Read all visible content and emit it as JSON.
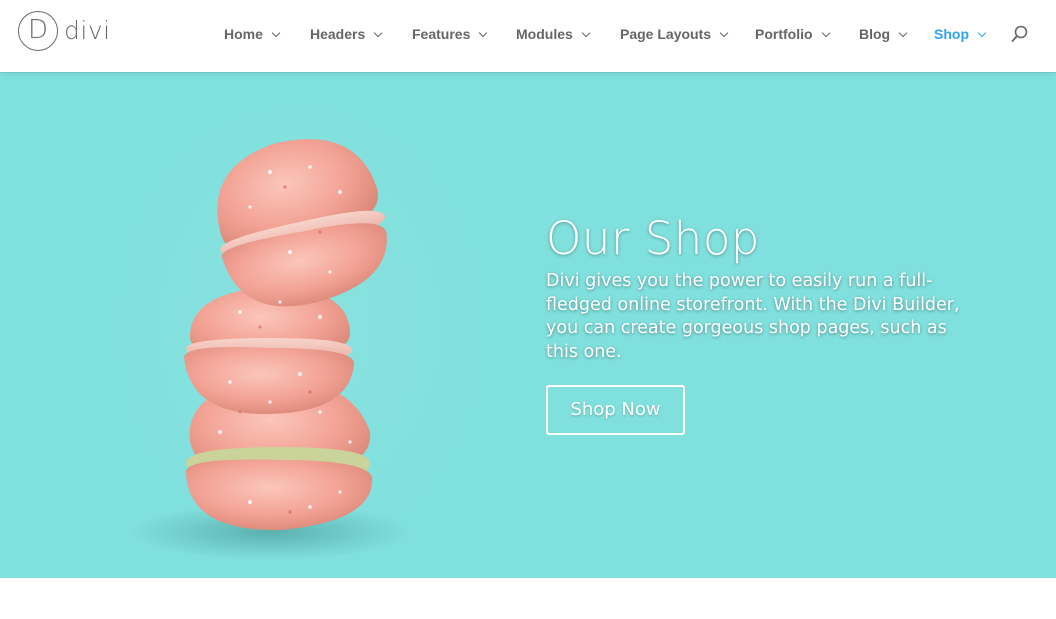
{
  "brand": {
    "logo_letter": "D",
    "logo_word": "divi"
  },
  "nav": {
    "items": [
      {
        "label": "Home"
      },
      {
        "label": "Headers"
      },
      {
        "label": "Features"
      },
      {
        "label": "Modules"
      },
      {
        "label": "Page Layouts"
      },
      {
        "label": "Portfolio"
      },
      {
        "label": "Blog"
      },
      {
        "label": "Shop",
        "active": true
      }
    ],
    "search_icon": "search-icon"
  },
  "hero": {
    "title": "Our Shop",
    "description": "Divi gives you the power to easily run a full-fledged online storefront. With the Divi Builder, you can create gorgeous shop pages, such as this one.",
    "cta_label": "Shop Now",
    "image": "macaron-stack-image"
  },
  "colors": {
    "accent": "#2ea3f2",
    "hero_bg": "#80e0dd",
    "nav_text": "#666666",
    "macaron": "#f3a79c"
  }
}
